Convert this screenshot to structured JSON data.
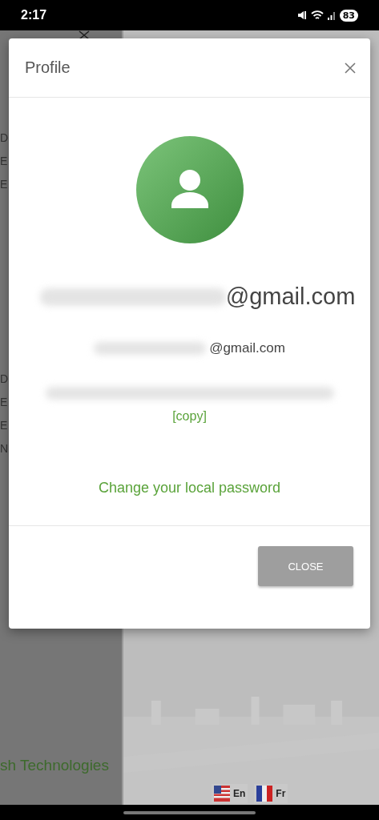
{
  "status_bar": {
    "time": "2:17",
    "battery": "83"
  },
  "drawer": {
    "groups": [
      {
        "lines": [
          "D",
          "E",
          "E"
        ]
      },
      {
        "lines": [
          "D",
          "E",
          "E",
          "N"
        ]
      }
    ],
    "footer": "sh Technologies"
  },
  "languages": [
    {
      "label": "En",
      "kind": "american"
    },
    {
      "label": "Fr",
      "kind": "french"
    }
  ],
  "dialog": {
    "title": "Profile",
    "primary_email": "@gmail.com",
    "secondary_email": "@gmail.com",
    "copy_link": "[copy]",
    "password_link": "Change your local password",
    "close_button": "CLOSE"
  }
}
